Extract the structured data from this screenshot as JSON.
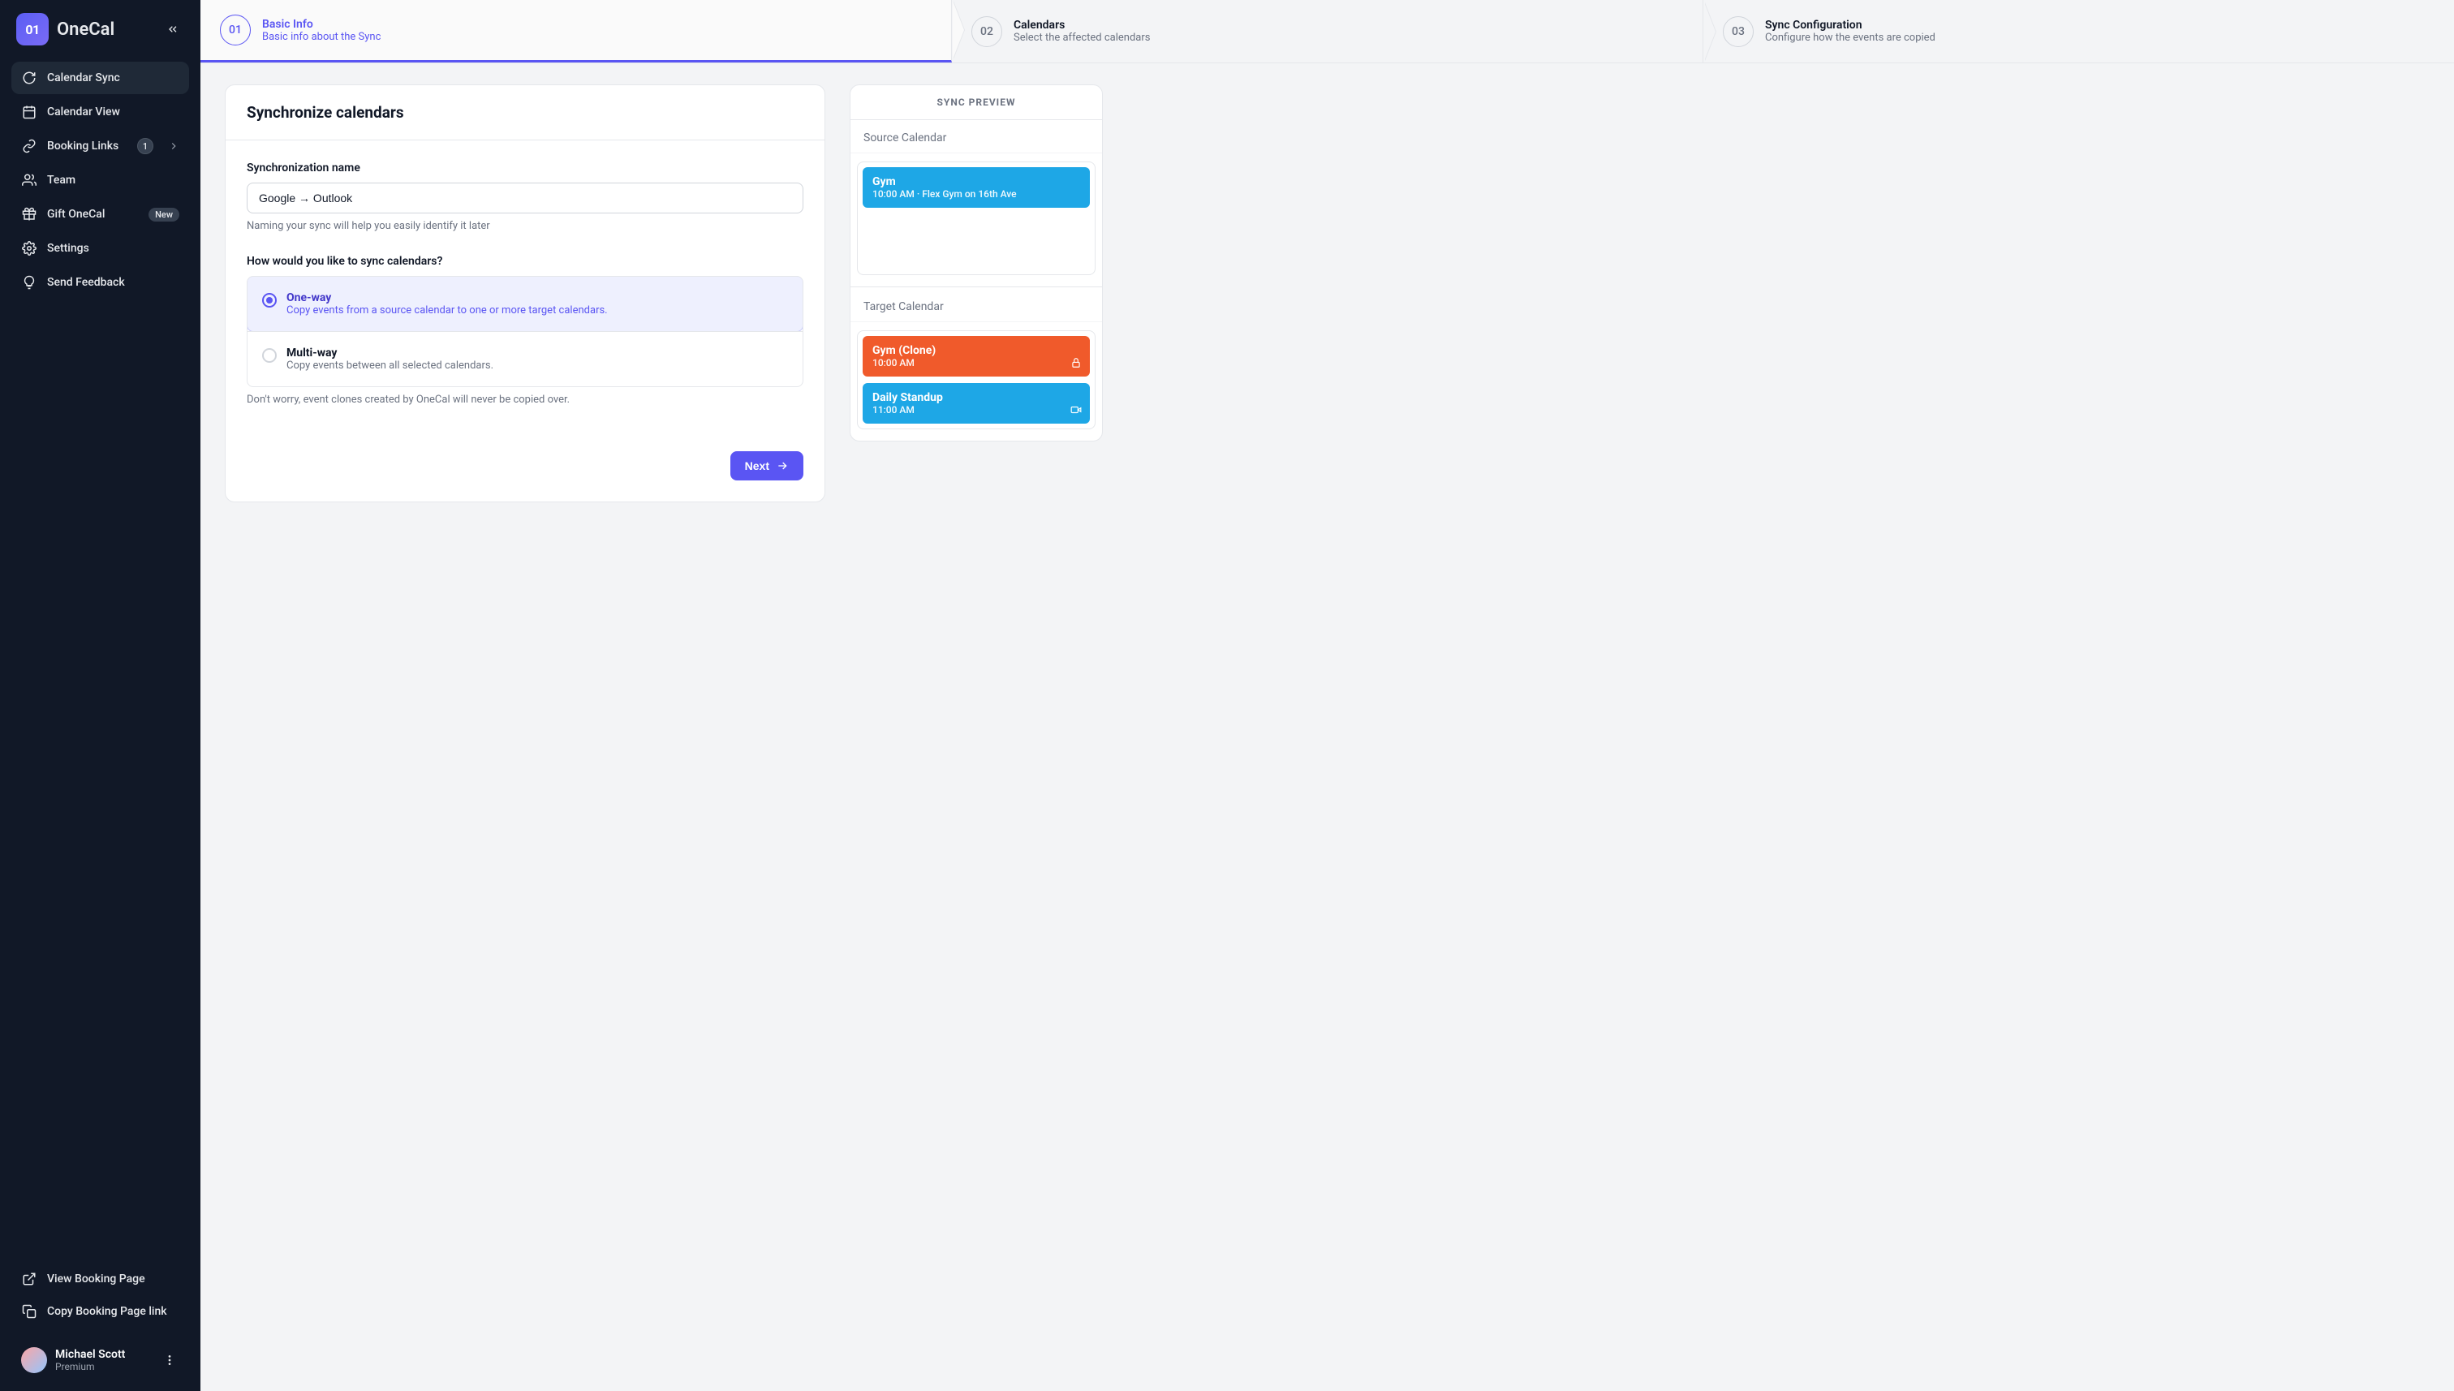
{
  "brand": {
    "mark": "01",
    "name": "OneCal"
  },
  "sidebar": {
    "items": [
      {
        "label": "Calendar Sync"
      },
      {
        "label": "Calendar View"
      },
      {
        "label": "Booking Links",
        "count": "1"
      },
      {
        "label": "Team"
      },
      {
        "label": "Gift OneCal",
        "badge": "New"
      },
      {
        "label": "Settings"
      },
      {
        "label": "Send Feedback"
      }
    ],
    "bottom": [
      {
        "label": "View Booking Page"
      },
      {
        "label": "Copy Booking Page link"
      }
    ]
  },
  "user": {
    "name": "Michael Scott",
    "plan": "Premium"
  },
  "stepper": [
    {
      "num": "01",
      "title": "Basic Info",
      "sub": "Basic info about the Sync"
    },
    {
      "num": "02",
      "title": "Calendars",
      "sub": "Select the affected calendars"
    },
    {
      "num": "03",
      "title": "Sync Configuration",
      "sub": "Configure how the events are copied"
    }
  ],
  "form": {
    "page_title": "Synchronize calendars",
    "name_label": "Synchronization name",
    "name_value": "Google → Outlook",
    "name_hint": "Naming your sync will help you easily identify it later",
    "direction_label": "How would you like to sync calendars?",
    "options": [
      {
        "title": "One-way",
        "desc": "Copy events from a source calendar to one or more target calendars."
      },
      {
        "title": "Multi-way",
        "desc": "Copy events between all selected calendars."
      }
    ],
    "direction_hint": "Don't worry, event clones created by OneCal will never be copied over.",
    "next": "Next"
  },
  "preview": {
    "header": "SYNC PREVIEW",
    "source_label": "Source Calendar",
    "target_label": "Target Calendar",
    "source_events": [
      {
        "title": "Gym",
        "sub": "10:00 AM · Flex Gym on 16th Ave",
        "color": "#1ea7e6"
      }
    ],
    "target_events": [
      {
        "title": "Gym (Clone)",
        "sub": "10:00 AM",
        "color": "#f05a2b",
        "icon": "lock"
      },
      {
        "title": "Daily Standup",
        "sub": "11:00 AM",
        "color": "#1ea7e6",
        "icon": "video"
      }
    ]
  }
}
